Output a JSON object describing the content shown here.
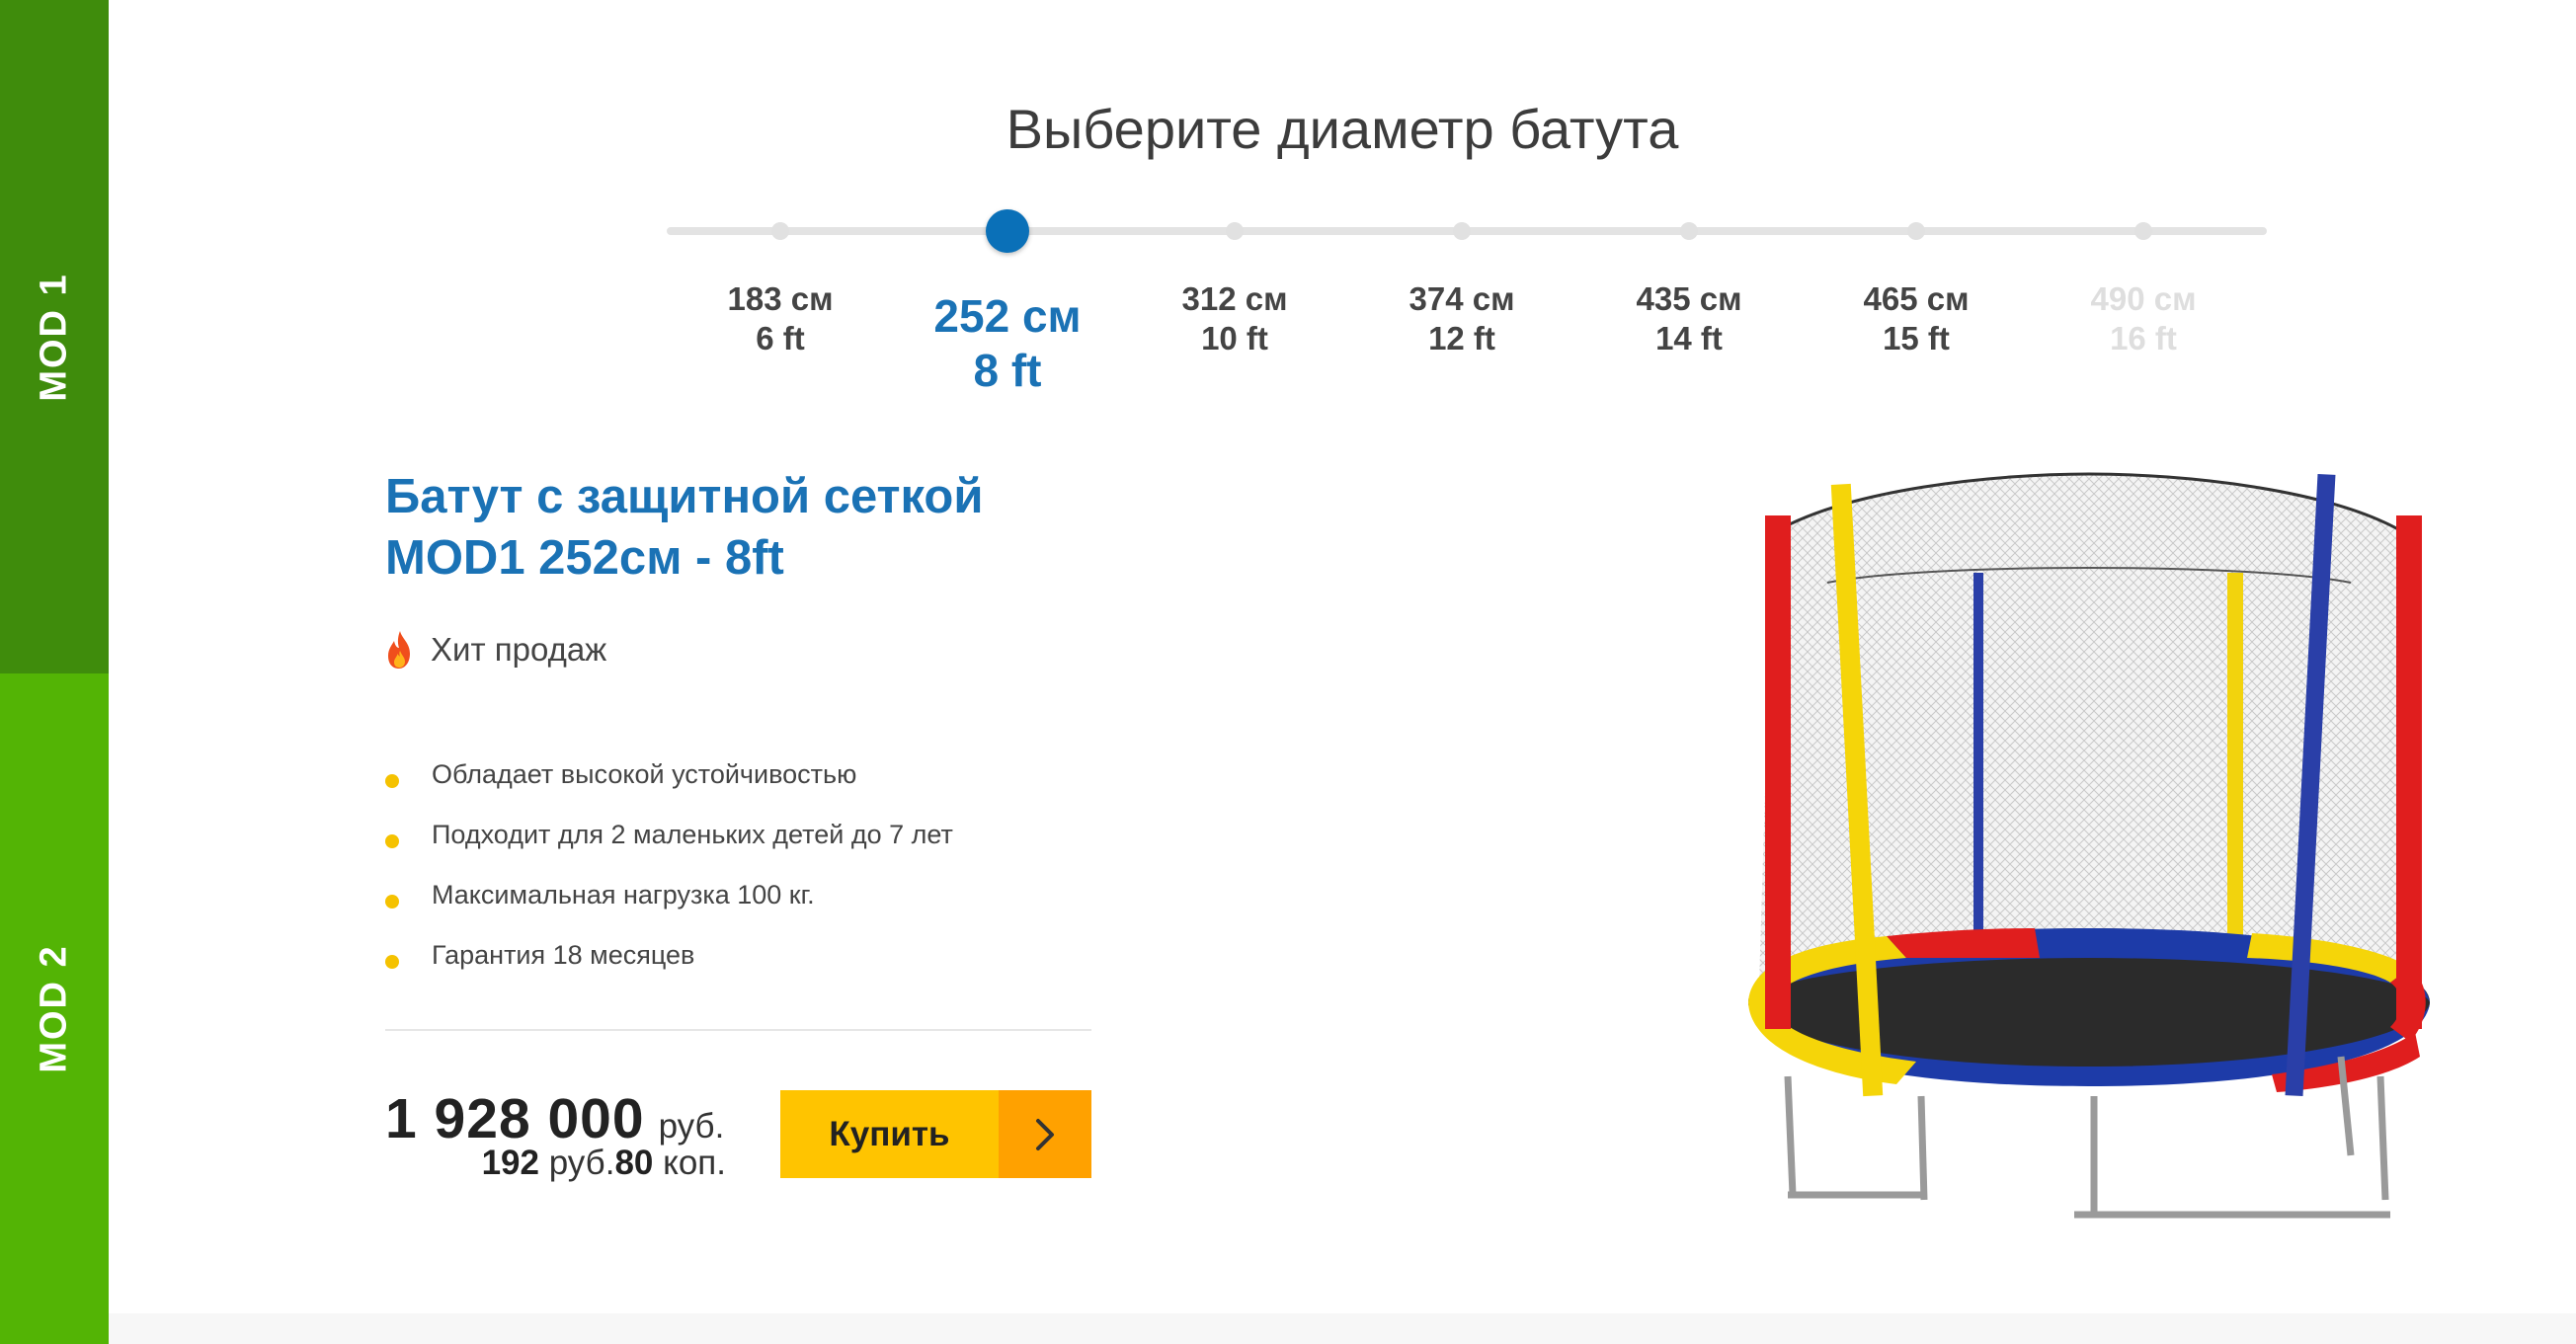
{
  "sidebar": {
    "tabs": [
      {
        "label": "MOD 1",
        "active": true
      },
      {
        "label": "MOD 2",
        "active": false
      }
    ]
  },
  "heading": "Выберите диаметр батута",
  "slider": {
    "selected_index": 1,
    "stops": [
      {
        "cm": "183 см",
        "ft": "6 ft",
        "state": "normal"
      },
      {
        "cm": "252 см",
        "ft": "8 ft",
        "state": "active"
      },
      {
        "cm": "312 см",
        "ft": "10 ft",
        "state": "normal"
      },
      {
        "cm": "374 см",
        "ft": "12 ft",
        "state": "normal"
      },
      {
        "cm": "435 см",
        "ft": "14 ft",
        "state": "normal"
      },
      {
        "cm": "465 см",
        "ft": "15 ft",
        "state": "normal"
      },
      {
        "cm": "490 см",
        "ft": "16 ft",
        "state": "disabled"
      }
    ]
  },
  "product": {
    "title_line1": "Батут с защитной сеткой",
    "title_line2": "MOD1 252см - 8ft",
    "badge": {
      "icon": "fire-icon",
      "text": "Хит продаж"
    },
    "features": [
      "Обладает высокой устойчивостью",
      "Подходит для 2 маленьких детей до 7 лет",
      "Максимальная нагрузка 100 кг.",
      "Гарантия 18 месяцев"
    ],
    "price": {
      "main_amount": "1 928 000",
      "main_currency": "руб.",
      "alt_rub": "192",
      "alt_rub_label": "руб.",
      "alt_kop": "80",
      "alt_kop_label": "коп."
    },
    "buy_label": "Купить",
    "image": "trampoline-with-safety-net"
  },
  "colors": {
    "mod1_tab": "#3f8c0c",
    "mod2_tab": "#53b405",
    "accent_blue": "#1a72b5",
    "slider_knob": "#0a70b8",
    "bullet": "#f5c200",
    "button": "#ffc400",
    "button_arrow": "#ffa100"
  }
}
